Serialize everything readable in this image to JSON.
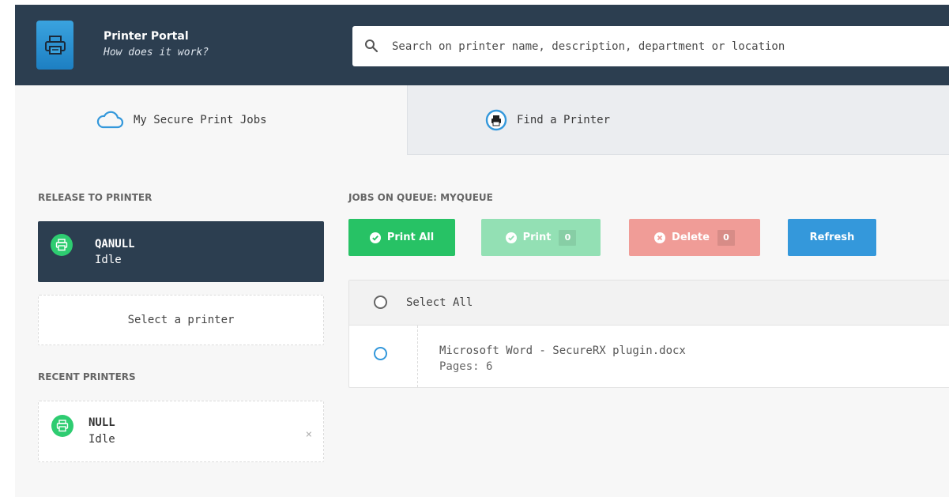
{
  "header": {
    "title": "Printer Portal",
    "subtitle": "How does it work?",
    "logo_icon": "printer-icon",
    "search": {
      "placeholder": "Search on printer name, description, department or location",
      "icon": "search-icon"
    }
  },
  "tabs": [
    {
      "label": "My Secure Print Jobs",
      "icon": "cloud-icon",
      "active": true
    },
    {
      "label": "Find a Printer",
      "icon": "printer-circle-icon",
      "active": false
    }
  ],
  "release": {
    "title": "RELEASE TO PRINTER",
    "selected_printer": {
      "name": "QANULL",
      "status": "Idle",
      "icon": "printer-icon"
    },
    "select_placeholder": "Select a printer"
  },
  "recent": {
    "title": "RECENT PRINTERS",
    "printers": [
      {
        "name": "NULL",
        "status": "Idle",
        "icon": "printer-icon",
        "remove": "×"
      }
    ]
  },
  "jobs": {
    "title": "JOBS ON QUEUE: MYQUEUE",
    "buttons": {
      "print_all": "Print All",
      "print": "Print",
      "print_count": "0",
      "delete": "Delete",
      "delete_count": "0",
      "refresh": "Refresh"
    },
    "select_all": "Select All",
    "items": [
      {
        "name": "Microsoft Word - SecureRX plugin.docx",
        "pages": "Pages: 6"
      }
    ]
  },
  "colors": {
    "header_bg": "#2c3e50",
    "green": "#27c265",
    "green_disabled": "#93e0b4",
    "red_disabled": "#f09c97",
    "blue": "#3498db"
  }
}
